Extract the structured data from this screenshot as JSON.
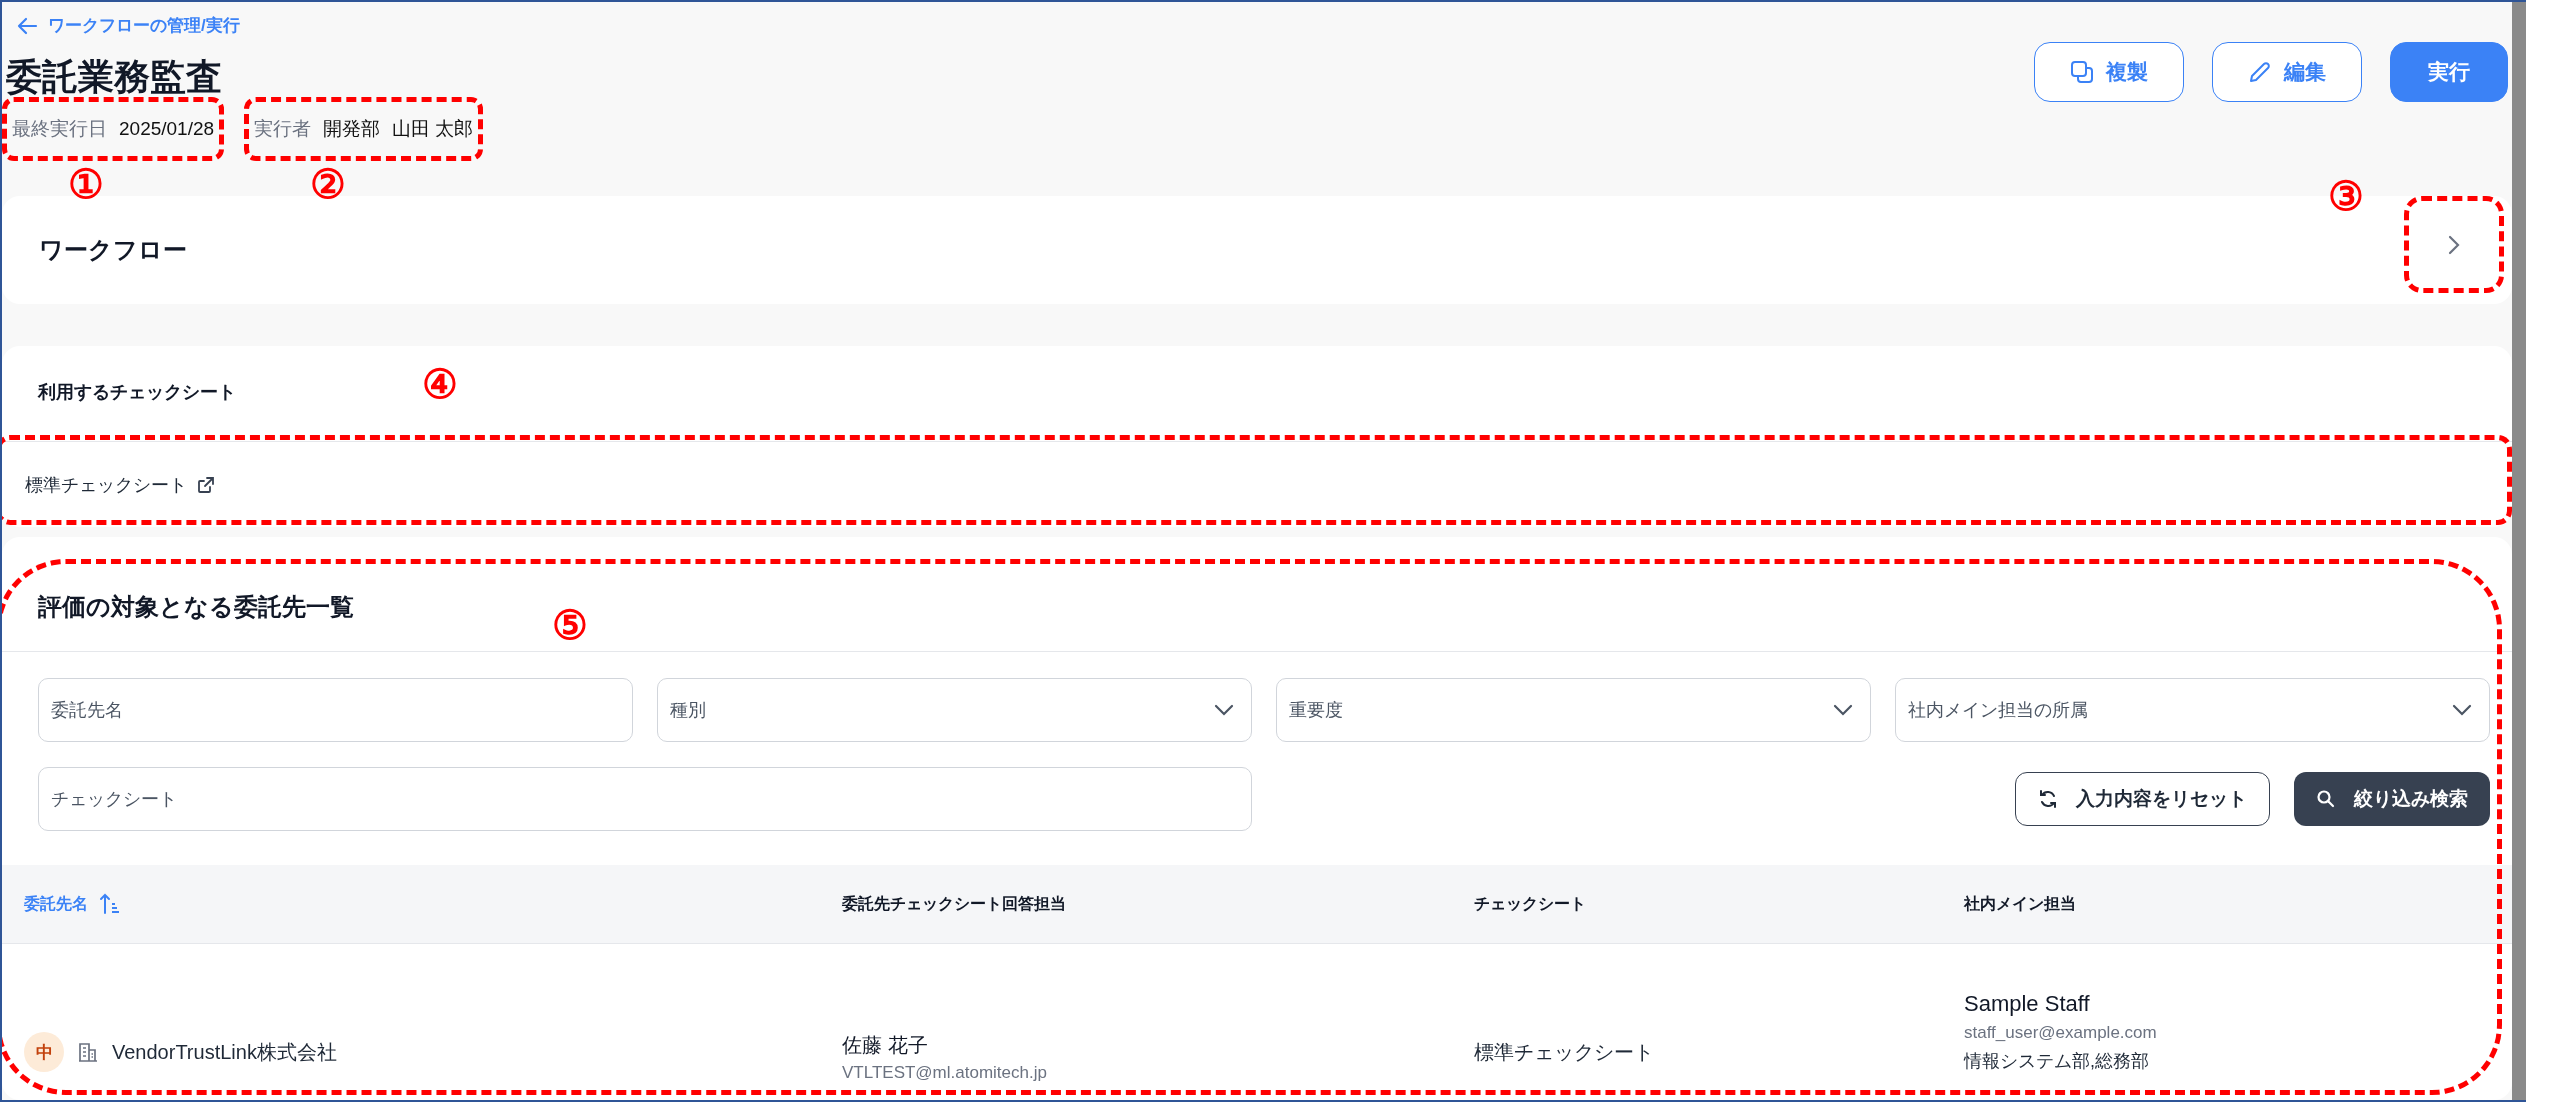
{
  "breadcrumb": {
    "label": "ワークフローの管理/実行"
  },
  "title": "委託業務監査",
  "meta": [
    {
      "label": "最終実行日",
      "value": "2025/01/28"
    },
    {
      "label": "実行者",
      "value": "開発部",
      "extra": "山田 太郎"
    }
  ],
  "actions": [
    {
      "label": "複製",
      "kind": "copy"
    },
    {
      "label": "編集",
      "kind": "edit"
    },
    {
      "label": "実行",
      "kind": "primary"
    }
  ],
  "workflow": {
    "title": "ワークフロー"
  },
  "checksheets": {
    "title": "利用するチェックシート",
    "items": [
      "標準チェックシート"
    ]
  },
  "vendors": {
    "title": "評価の対象となる委託先一覧",
    "filters": [
      {
        "placeholder": "委託先名",
        "kind": "text"
      },
      {
        "placeholder": "種別",
        "kind": "select"
      },
      {
        "placeholder": "重要度",
        "kind": "select"
      },
      {
        "placeholder": "社内メイン担当の所属",
        "kind": "select"
      },
      {
        "placeholder": "チェックシート",
        "kind": "text"
      }
    ],
    "reset_button": "入力内容をリセット",
    "search_button": "絞り込み検索",
    "columns": [
      {
        "label": "委託先名",
        "sorted": true
      },
      {
        "label": "委託先チェックシート回答担当",
        "sorted": false
      },
      {
        "label": "チェックシート",
        "sorted": false
      },
      {
        "label": "社内メイン担当",
        "sorted": false
      }
    ],
    "rows": [
      {
        "importance": "中",
        "vendor": "VendorTrustLink株式会社",
        "respondent": "佐藤 花子",
        "respondent_email": "VTLTEST@ml.atomitech.jp",
        "checksheet": "標準チェックシート",
        "staff": "Sample Staff",
        "staff_email": "staff_user@example.com",
        "staff_dept": "情報システム部,総務部"
      }
    ]
  },
  "annotations": [
    {
      "label": "①"
    },
    {
      "label": "②"
    },
    {
      "label": "③"
    },
    {
      "label": "④"
    },
    {
      "label": "⑤"
    }
  ]
}
